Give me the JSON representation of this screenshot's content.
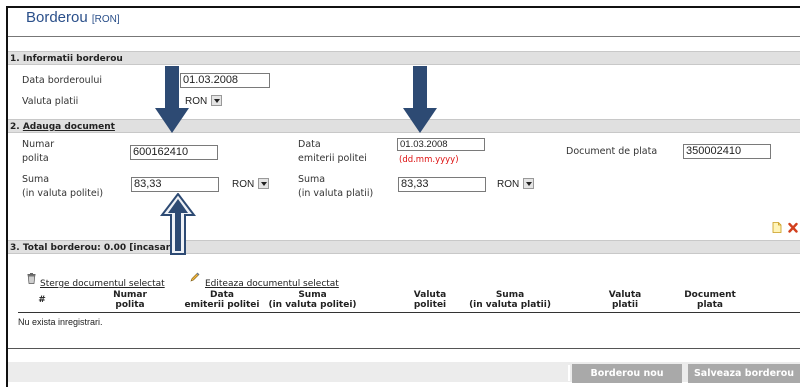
{
  "header": {
    "title": "Borderou",
    "currency_tag": "[RON]"
  },
  "section1": {
    "title": "1. Informatii borderou",
    "date_label": "Data borderoului",
    "date_value": "01.03.2008",
    "currency_label": "Valuta platii",
    "currency_value": "RON"
  },
  "section2": {
    "number": "2.",
    "title": "Adauga document",
    "policy_number_label_1": "Numar",
    "policy_number_label_2": "polita",
    "policy_number_value": "600162410",
    "issue_date_label_1": "Data",
    "issue_date_label_2": "emiterii politei",
    "issue_date_value": "01.03.2008",
    "issue_date_hint": "(dd.mm.yyyy)",
    "payment_doc_label": "Document de plata",
    "payment_doc_value": "350002410",
    "amount_policy_label_1": "Suma",
    "amount_policy_label_2": "(in valuta politei)",
    "amount_policy_value": "83,33",
    "amount_policy_currency": "RON",
    "amount_payment_label_1": "Suma",
    "amount_payment_label_2": "(in valuta platii)",
    "amount_payment_value": "83,33",
    "amount_payment_currency": "RON"
  },
  "section3": {
    "title": "3. Total borderou: 0.00 [incasar"
  },
  "grid": {
    "delete_link": "Sterge documentul selectat",
    "edit_link": "Editeaza documentul selectat",
    "columns": [
      {
        "l1": "#",
        "l2": ""
      },
      {
        "l1": "Numar",
        "l2": "polita"
      },
      {
        "l1": "Data",
        "l2": "emiterii politei"
      },
      {
        "l1": "Suma",
        "l2": "(in valuta politei)"
      },
      {
        "l1": "Valuta",
        "l2": "politei"
      },
      {
        "l1": "Suma",
        "l2": "(in valuta platii)"
      },
      {
        "l1": "Valuta",
        "l2": "platii"
      },
      {
        "l1": "Document",
        "l2": "plata"
      }
    ],
    "empty_text": "Nu exista inregistrari."
  },
  "footer": {
    "new_button": "Borderou nou",
    "save_button": "Salveaza borderou"
  },
  "colors": {
    "title": "#2a4f8a",
    "arrow": "#2d4a73",
    "section_bg": "#e0e0e0",
    "button_bg": "#a9a9a9",
    "hint": "#dd1111"
  }
}
